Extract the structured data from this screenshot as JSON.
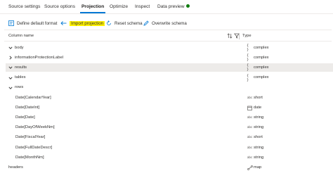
{
  "tabs": [
    {
      "label": "Source settings"
    },
    {
      "label": "Source options"
    },
    {
      "label": "Projection"
    },
    {
      "label": "Optimize"
    },
    {
      "label": "Inspect"
    },
    {
      "label": "Data preview"
    }
  ],
  "active_tab": "Projection",
  "colors": {
    "accent": "#0078d4",
    "status_ok": "#107c10",
    "highlight": "#fff100",
    "selected_row": "#edebe9"
  },
  "toolbar": {
    "define_default_format": "Define default format",
    "import_projection": "Import projection",
    "reset_schema": "Reset schema",
    "overwrite_schema": "Overwrite schema"
  },
  "columns": {
    "name": "Column name",
    "type": "Type"
  },
  "rows": [
    {
      "name": "body",
      "type": "complex",
      "type_icon": "braces-icon",
      "chevron": "down"
    },
    {
      "name": "informationProtectionLabel",
      "type": "complex",
      "type_icon": "braces-icon",
      "chevron": "right"
    },
    {
      "name": "results",
      "type": "complex",
      "type_icon": "braces-icon",
      "chevron": "down",
      "selected": true
    },
    {
      "name": "tables",
      "type": "complex",
      "type_icon": "braces-icon",
      "chevron": "down"
    },
    {
      "name": "rows",
      "type": "",
      "type_icon": "",
      "chevron": "down"
    },
    {
      "name": "Date[CalendarYear]",
      "type": "short",
      "type_icon": "abc-icon"
    },
    {
      "name": "Date[DateInt]",
      "type": "date",
      "type_icon": "calendar-icon"
    },
    {
      "name": "Date[Date]",
      "type": "string",
      "type_icon": "abc-icon"
    },
    {
      "name": "Date[DayOfWeekNm]",
      "type": "string",
      "type_icon": "abc-icon"
    },
    {
      "name": "Date[FiscalYear]",
      "type": "short",
      "type_icon": "abc-icon"
    },
    {
      "name": "Date[FullDateDescr]",
      "type": "string",
      "type_icon": "abc-icon"
    },
    {
      "name": "Date[MonthNm]",
      "type": "string",
      "type_icon": "abc-icon"
    },
    {
      "name": "headers",
      "type": "map",
      "type_icon": "map-icon"
    }
  ]
}
